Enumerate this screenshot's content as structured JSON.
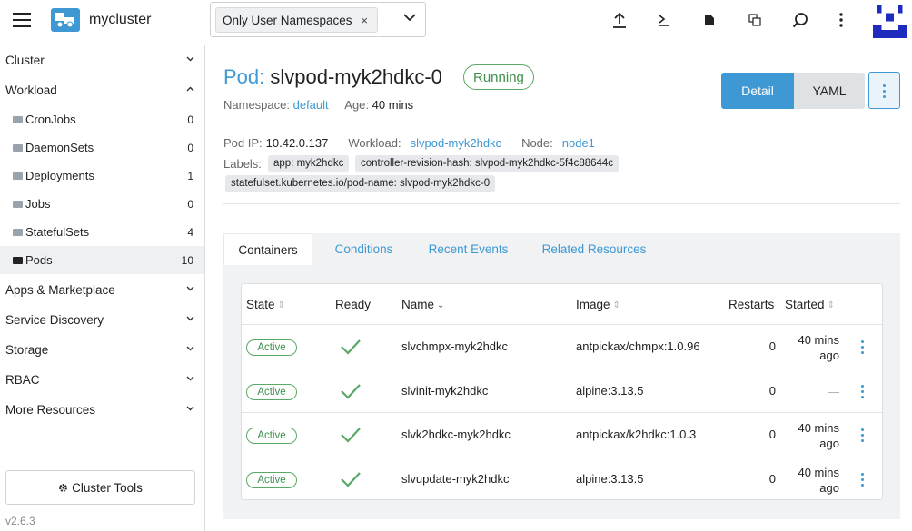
{
  "header": {
    "cluster_name": "mycluster",
    "namespace_filter": "Only User Namespaces",
    "namespace_remove": "×",
    "icons": [
      "menu-icon",
      "upload-icon",
      "kubectl-shell-icon",
      "download-kubeconfig-icon",
      "copy-kubeconfig-icon",
      "search-icon",
      "more-vert-icon"
    ]
  },
  "sidebar": {
    "groups": [
      {
        "label": "Cluster"
      },
      {
        "label": "Workload"
      },
      {
        "label": "Apps & Marketplace"
      },
      {
        "label": "Service Discovery"
      },
      {
        "label": "Storage"
      },
      {
        "label": "RBAC"
      },
      {
        "label": "More Resources"
      }
    ],
    "items": [
      {
        "label": "CronJobs",
        "count": "0"
      },
      {
        "label": "DaemonSets",
        "count": "0"
      },
      {
        "label": "Deployments",
        "count": "1"
      },
      {
        "label": "Jobs",
        "count": "0"
      },
      {
        "label": "StatefulSets",
        "count": "4"
      },
      {
        "label": "Pods",
        "count": "10"
      }
    ],
    "cluster_tools": "Cluster Tools",
    "version": "v2.6.3"
  },
  "pod": {
    "kind": "Pod:",
    "name": "slvpod-myk2hdkc-0",
    "status": "Running",
    "namespace_label": "Namespace:",
    "namespace": "default",
    "age_label": "Age:",
    "age": "40 mins",
    "ip_label": "Pod IP:",
    "ip": "10.42.0.137",
    "workload_label": "Workload:",
    "workload": "slvpod-myk2hdkc",
    "node_label": "Node:",
    "node": "node1",
    "labels_label": "Labels:",
    "labels": [
      "app: myk2hdkc",
      "controller-revision-hash: slvpod-myk2hdkc-5f4c88644c",
      "statefulset.kubernetes.io/pod-name: slvpod-myk2hdkc-0"
    ]
  },
  "view_buttons": {
    "detail": "Detail",
    "yaml": "YAML"
  },
  "tabs": [
    "Containers",
    "Conditions",
    "Recent Events",
    "Related Resources"
  ],
  "table": {
    "headers": {
      "state": "State",
      "ready": "Ready",
      "name": "Name",
      "image": "Image",
      "restarts": "Restarts",
      "started": "Started"
    },
    "rows": [
      {
        "state": "Active",
        "name": "slvchmpx-myk2hdkc",
        "image": "antpickax/chmpx:1.0.96",
        "restarts": "0",
        "started_1": "40 mins",
        "started_2": "ago"
      },
      {
        "state": "Active",
        "name": "slvinit-myk2hdkc",
        "image": "alpine:3.13.5",
        "restarts": "0",
        "started_1": "—",
        "started_2": ""
      },
      {
        "state": "Active",
        "name": "slvk2hdkc-myk2hdkc",
        "image": "antpickax/k2hdkc:1.0.3",
        "restarts": "0",
        "started_1": "40 mins",
        "started_2": "ago"
      },
      {
        "state": "Active",
        "name": "slvupdate-myk2hdkc",
        "image": "alpine:3.13.5",
        "restarts": "0",
        "started_1": "40 mins",
        "started_2": "ago"
      }
    ]
  },
  "colors": {
    "accent": "#3d98d3",
    "success": "#5aa866"
  }
}
